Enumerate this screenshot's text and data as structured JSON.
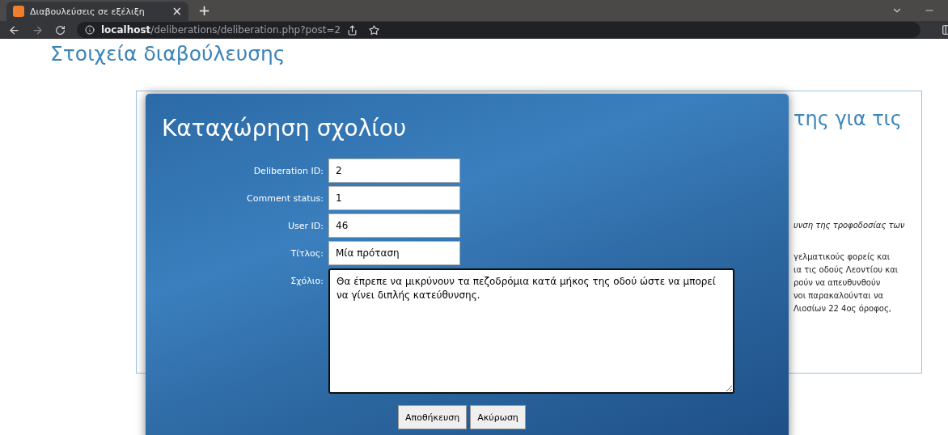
{
  "browser": {
    "tab": {
      "title": "Διαβουλεύσεις σε εξέλιξη",
      "close": "×",
      "selected": true
    },
    "new_tab": "+",
    "url": {
      "host": "localhost",
      "path": "/deliberations/deliberation.php?post=2"
    }
  },
  "page": {
    "heading": "Στοιχεία διαβούλευσης",
    "card": {
      "title_fragment": "της για τις",
      "italic_fragment": "υνση της τροφοδοσίας των",
      "paragraph_lines": [
        "γελματικούς φορείς και",
        "ια τις οδούς Λεοντίου και",
        "ρούν να απευθυνθούν",
        "νοι παρακαλούνται να",
        "Λιοσίων 22 4ος όροφος,"
      ]
    }
  },
  "dialog": {
    "title": "Καταχώρηση σχολίου",
    "fields": [
      {
        "label": "Deliberation ID:",
        "value": "2"
      },
      {
        "label": "Comment status:",
        "value": "1"
      },
      {
        "label": "User ID:",
        "value": "46"
      },
      {
        "label": "Τίτλος:",
        "value": "Μία πρόταση"
      }
    ],
    "comment": {
      "label": "Σχόλιο:",
      "value": "Θα έπρεπε να μικρύνουν τα πεζοδρόμια κατά μήκος της οδού ώστε να μπορεί να γίνει διπλής κατεύθυνσης."
    },
    "buttons": [
      "Αποθήκευση",
      "Ακύρωση"
    ]
  }
}
